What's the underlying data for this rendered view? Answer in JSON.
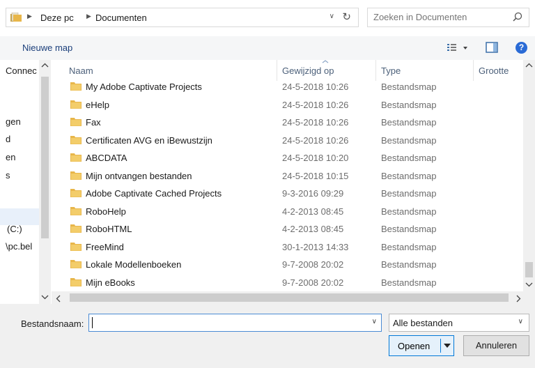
{
  "address": {
    "crumbs": [
      "Deze pc",
      "Documenten"
    ],
    "search_placeholder": "Zoeken in Documenten"
  },
  "toolbar": {
    "new_folder": "Nieuwe map",
    "help_label": "?"
  },
  "nav": {
    "items": [
      "Connec",
      "gen",
      "d",
      "en",
      "s",
      "(C:)",
      "\\pc.bel"
    ]
  },
  "list": {
    "columns": [
      "Naam",
      "Gewijzigd op",
      "Type",
      "Grootte"
    ],
    "rows": [
      {
        "name": "My Adobe Captivate Projects",
        "date": "24-5-2018 10:26",
        "type": "Bestandsmap"
      },
      {
        "name": "eHelp",
        "date": "24-5-2018 10:26",
        "type": "Bestandsmap"
      },
      {
        "name": "Fax",
        "date": "24-5-2018 10:26",
        "type": "Bestandsmap"
      },
      {
        "name": "Certificaten AVG en iBewustzijn",
        "date": "24-5-2018 10:26",
        "type": "Bestandsmap"
      },
      {
        "name": "ABCDATA",
        "date": "24-5-2018 10:20",
        "type": "Bestandsmap"
      },
      {
        "name": "Mijn ontvangen bestanden",
        "date": "24-5-2018 10:15",
        "type": "Bestandsmap"
      },
      {
        "name": "Adobe Captivate Cached Projects",
        "date": "9-3-2016 09:29",
        "type": "Bestandsmap"
      },
      {
        "name": "RoboHelp",
        "date": "4-2-2013 08:45",
        "type": "Bestandsmap"
      },
      {
        "name": "RoboHTML",
        "date": "4-2-2013 08:45",
        "type": "Bestandsmap"
      },
      {
        "name": "FreeMind",
        "date": "30-1-2013 14:33",
        "type": "Bestandsmap"
      },
      {
        "name": "Lokale Modellenboeken",
        "date": "9-7-2008 20:02",
        "type": "Bestandsmap"
      },
      {
        "name": "Mijn eBooks",
        "date": "9-7-2008 20:02",
        "type": "Bestandsmap"
      }
    ]
  },
  "bottom": {
    "filename_label": "Bestandsnaam:",
    "filename_value": "",
    "filter_value": "Alle bestanden",
    "open_label": "Openen",
    "cancel_label": "Annuleren"
  },
  "colors": {
    "folder": "#e8b64a",
    "accent": "#0078d7",
    "help": "#2a6bd6"
  }
}
